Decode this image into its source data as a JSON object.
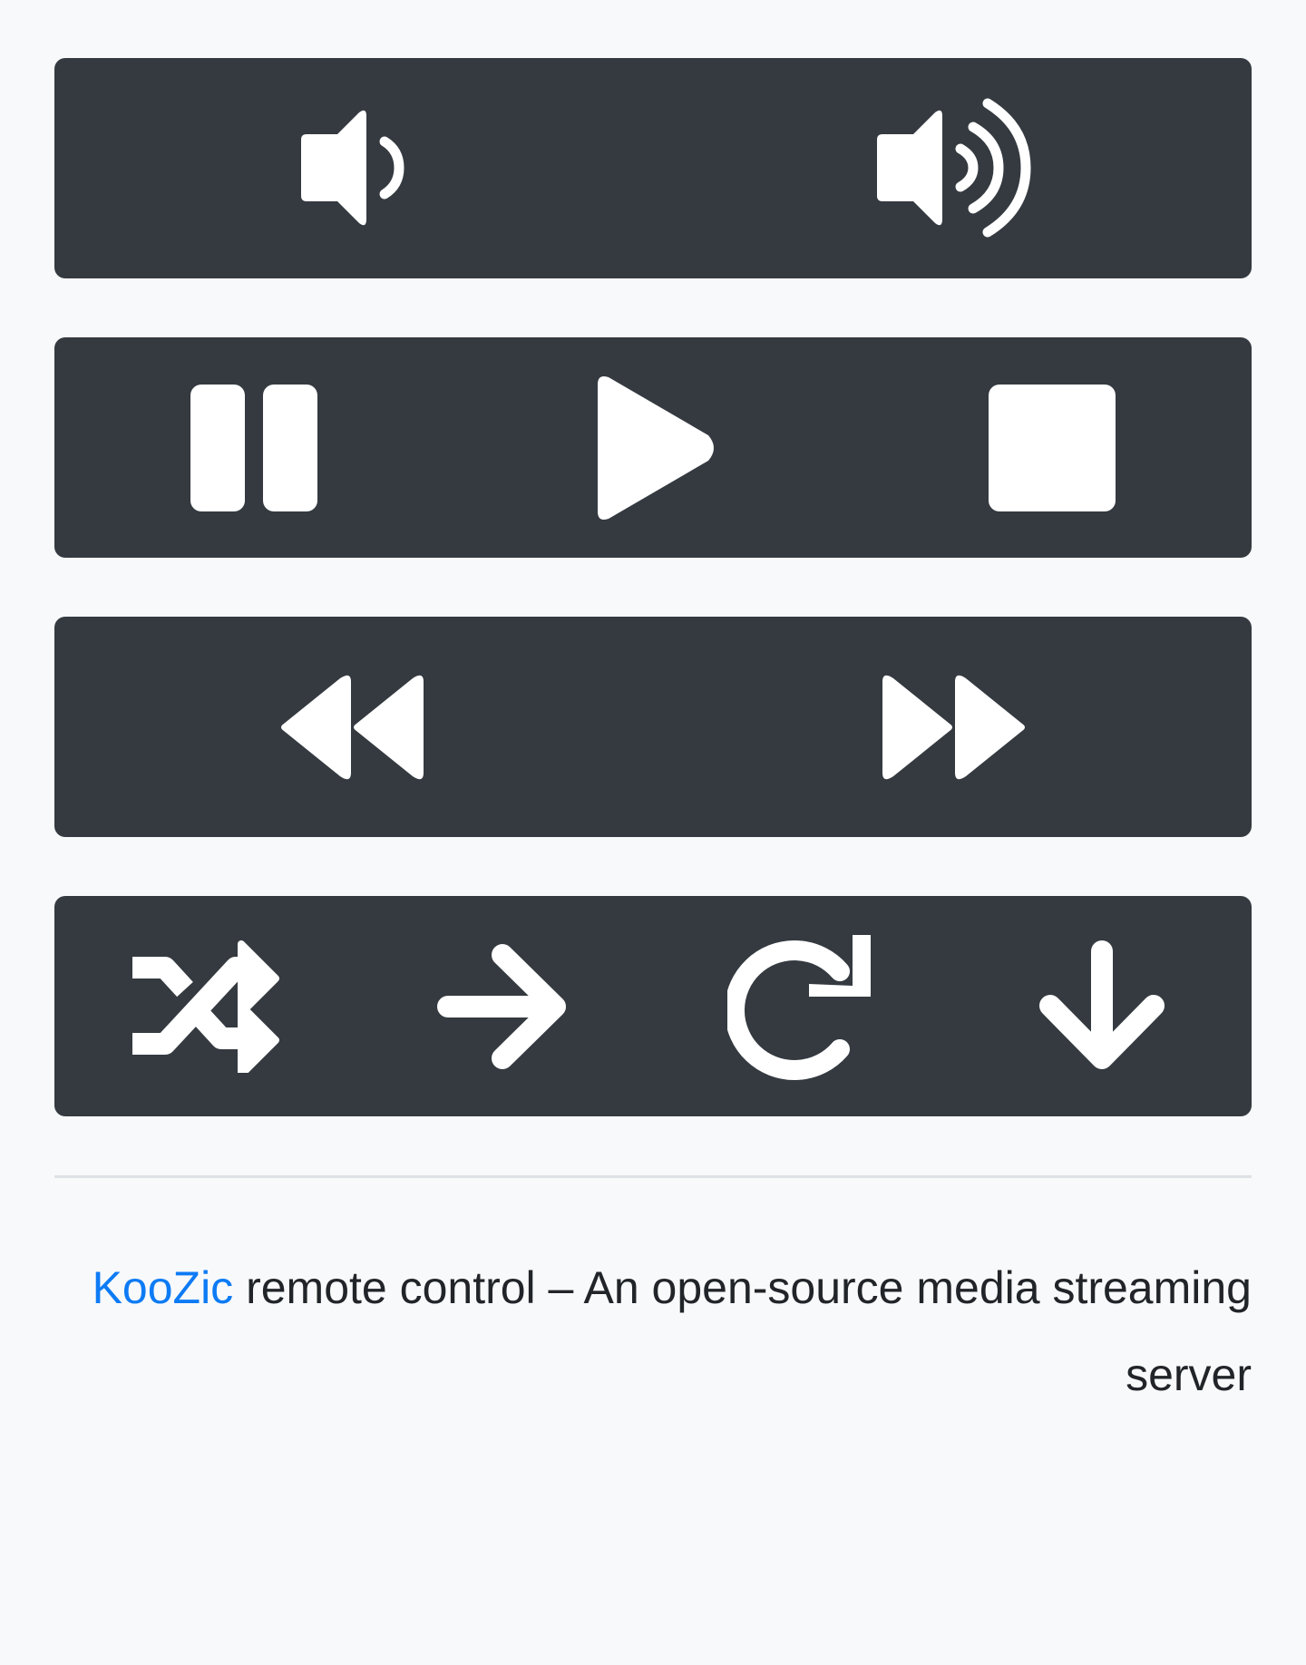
{
  "colors": {
    "page_background": "#f8f9fa",
    "panel_background": "#343a40",
    "icon_color": "#ffffff",
    "link_color": "#0d7bf5",
    "text_color": "#212529",
    "divider_color": "#dee2e6"
  },
  "controls": {
    "volume": [
      {
        "action": "volume-down",
        "icon": "volume-down-icon"
      },
      {
        "action": "volume-up",
        "icon": "volume-up-icon"
      }
    ],
    "playback": [
      {
        "action": "pause",
        "icon": "pause-icon"
      },
      {
        "action": "play",
        "icon": "play-icon"
      },
      {
        "action": "stop",
        "icon": "stop-icon"
      }
    ],
    "seek": [
      {
        "action": "previous",
        "icon": "rewind-icon"
      },
      {
        "action": "next",
        "icon": "fast-forward-icon"
      }
    ],
    "mode": [
      {
        "action": "shuffle",
        "icon": "shuffle-icon"
      },
      {
        "action": "forward",
        "icon": "arrow-right-icon"
      },
      {
        "action": "repeat",
        "icon": "redo-icon"
      },
      {
        "action": "down",
        "icon": "arrow-down-icon"
      }
    ]
  },
  "footer": {
    "brand_link": "KooZic",
    "text": " remote control – An open-source media streaming server"
  }
}
